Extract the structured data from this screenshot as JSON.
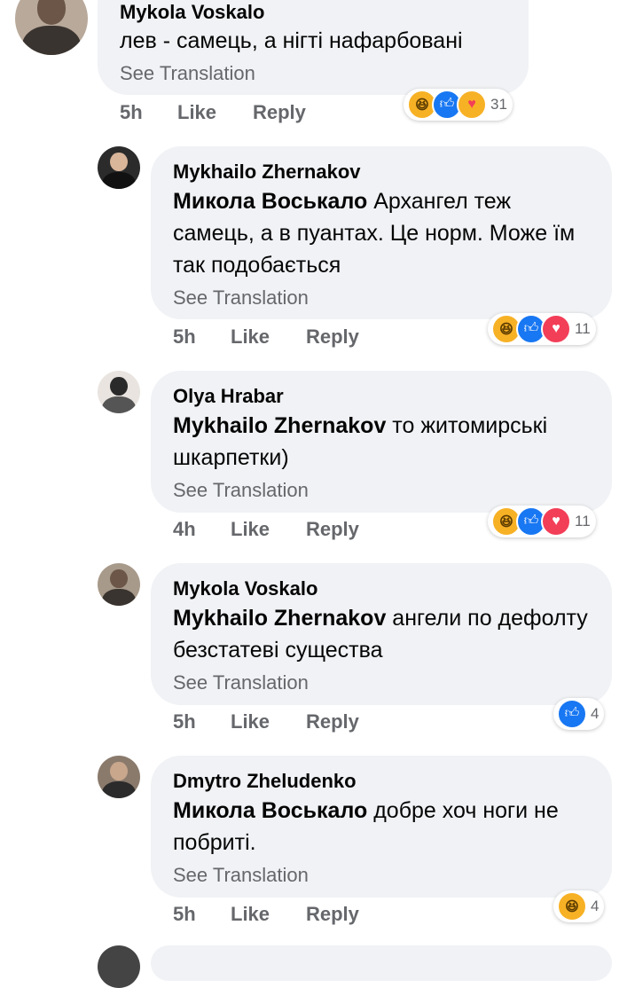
{
  "comments": [
    {
      "author": "Mykola Voskalo",
      "mention": "",
      "text": "лев - самець, а нігті нафарбовані",
      "see_translation": "See Translation",
      "time": "5h",
      "like_label": "Like",
      "reply_label": "Reply",
      "reactions": [
        "haha",
        "like",
        "care"
      ],
      "reaction_count": "31"
    },
    {
      "author": "Mykhailo Zhernakov",
      "mention": "Микола Воськало",
      "text": " Архангел теж самець, а в пуантах. Це норм. Може їм так подобається",
      "see_translation": "See Translation",
      "time": "5h",
      "like_label": "Like",
      "reply_label": "Reply",
      "reactions": [
        "haha",
        "like",
        "love"
      ],
      "reaction_count": "11"
    },
    {
      "author": "Olya Hrabar",
      "mention": "Mykhailo Zhernakov",
      "text": " то житомирські шкарпетки)",
      "see_translation": "See Translation",
      "time": "4h",
      "like_label": "Like",
      "reply_label": "Reply",
      "reactions": [
        "haha",
        "like",
        "love"
      ],
      "reaction_count": "11"
    },
    {
      "author": "Mykola Voskalo",
      "mention": "Mykhailo Zhernakov",
      "text": " ангели по дефолту безстатеві существа",
      "see_translation": "See Translation",
      "time": "5h",
      "like_label": "Like",
      "reply_label": "Reply",
      "reactions": [
        "like"
      ],
      "reaction_count": "4"
    },
    {
      "author": "Dmytro Zheludenko",
      "mention": "Микола Воськало",
      "text": " добре хоч ноги не побриті.",
      "see_translation": "See Translation",
      "time": "5h",
      "like_label": "Like",
      "reply_label": "Reply",
      "reactions": [
        "haha"
      ],
      "reaction_count": "4"
    }
  ],
  "colors": {
    "bubble": "#f0f2f5",
    "secondary_text": "#65676b",
    "like_blue": "#1877f2",
    "love_red": "#f33e58",
    "haha_yellow": "#f7b125"
  }
}
